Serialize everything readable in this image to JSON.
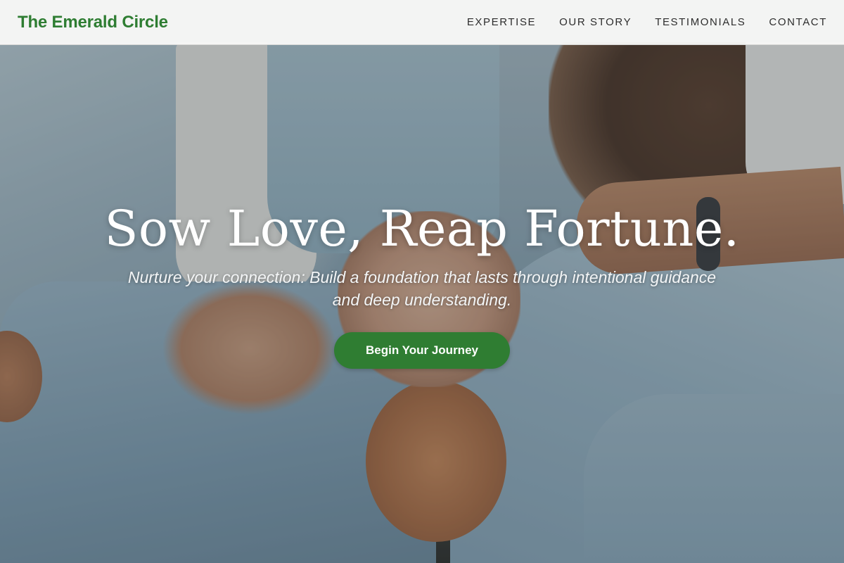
{
  "header": {
    "brand": "The Emerald Circle",
    "nav": [
      {
        "label": "EXPERTISE"
      },
      {
        "label": "OUR STORY"
      },
      {
        "label": "TESTIMONIALS"
      },
      {
        "label": "CONTACT"
      }
    ]
  },
  "hero": {
    "headline": "Sow Love, Reap Fortune.",
    "subheadline": "Nurture your connection: Build a foundation that lasts through intentional guidance and deep understanding.",
    "cta_label": "Begin Your Journey"
  },
  "colors": {
    "brand": "#2e7d32",
    "cta_background": "#2f7d32",
    "header_background": "#f8f8f7"
  }
}
